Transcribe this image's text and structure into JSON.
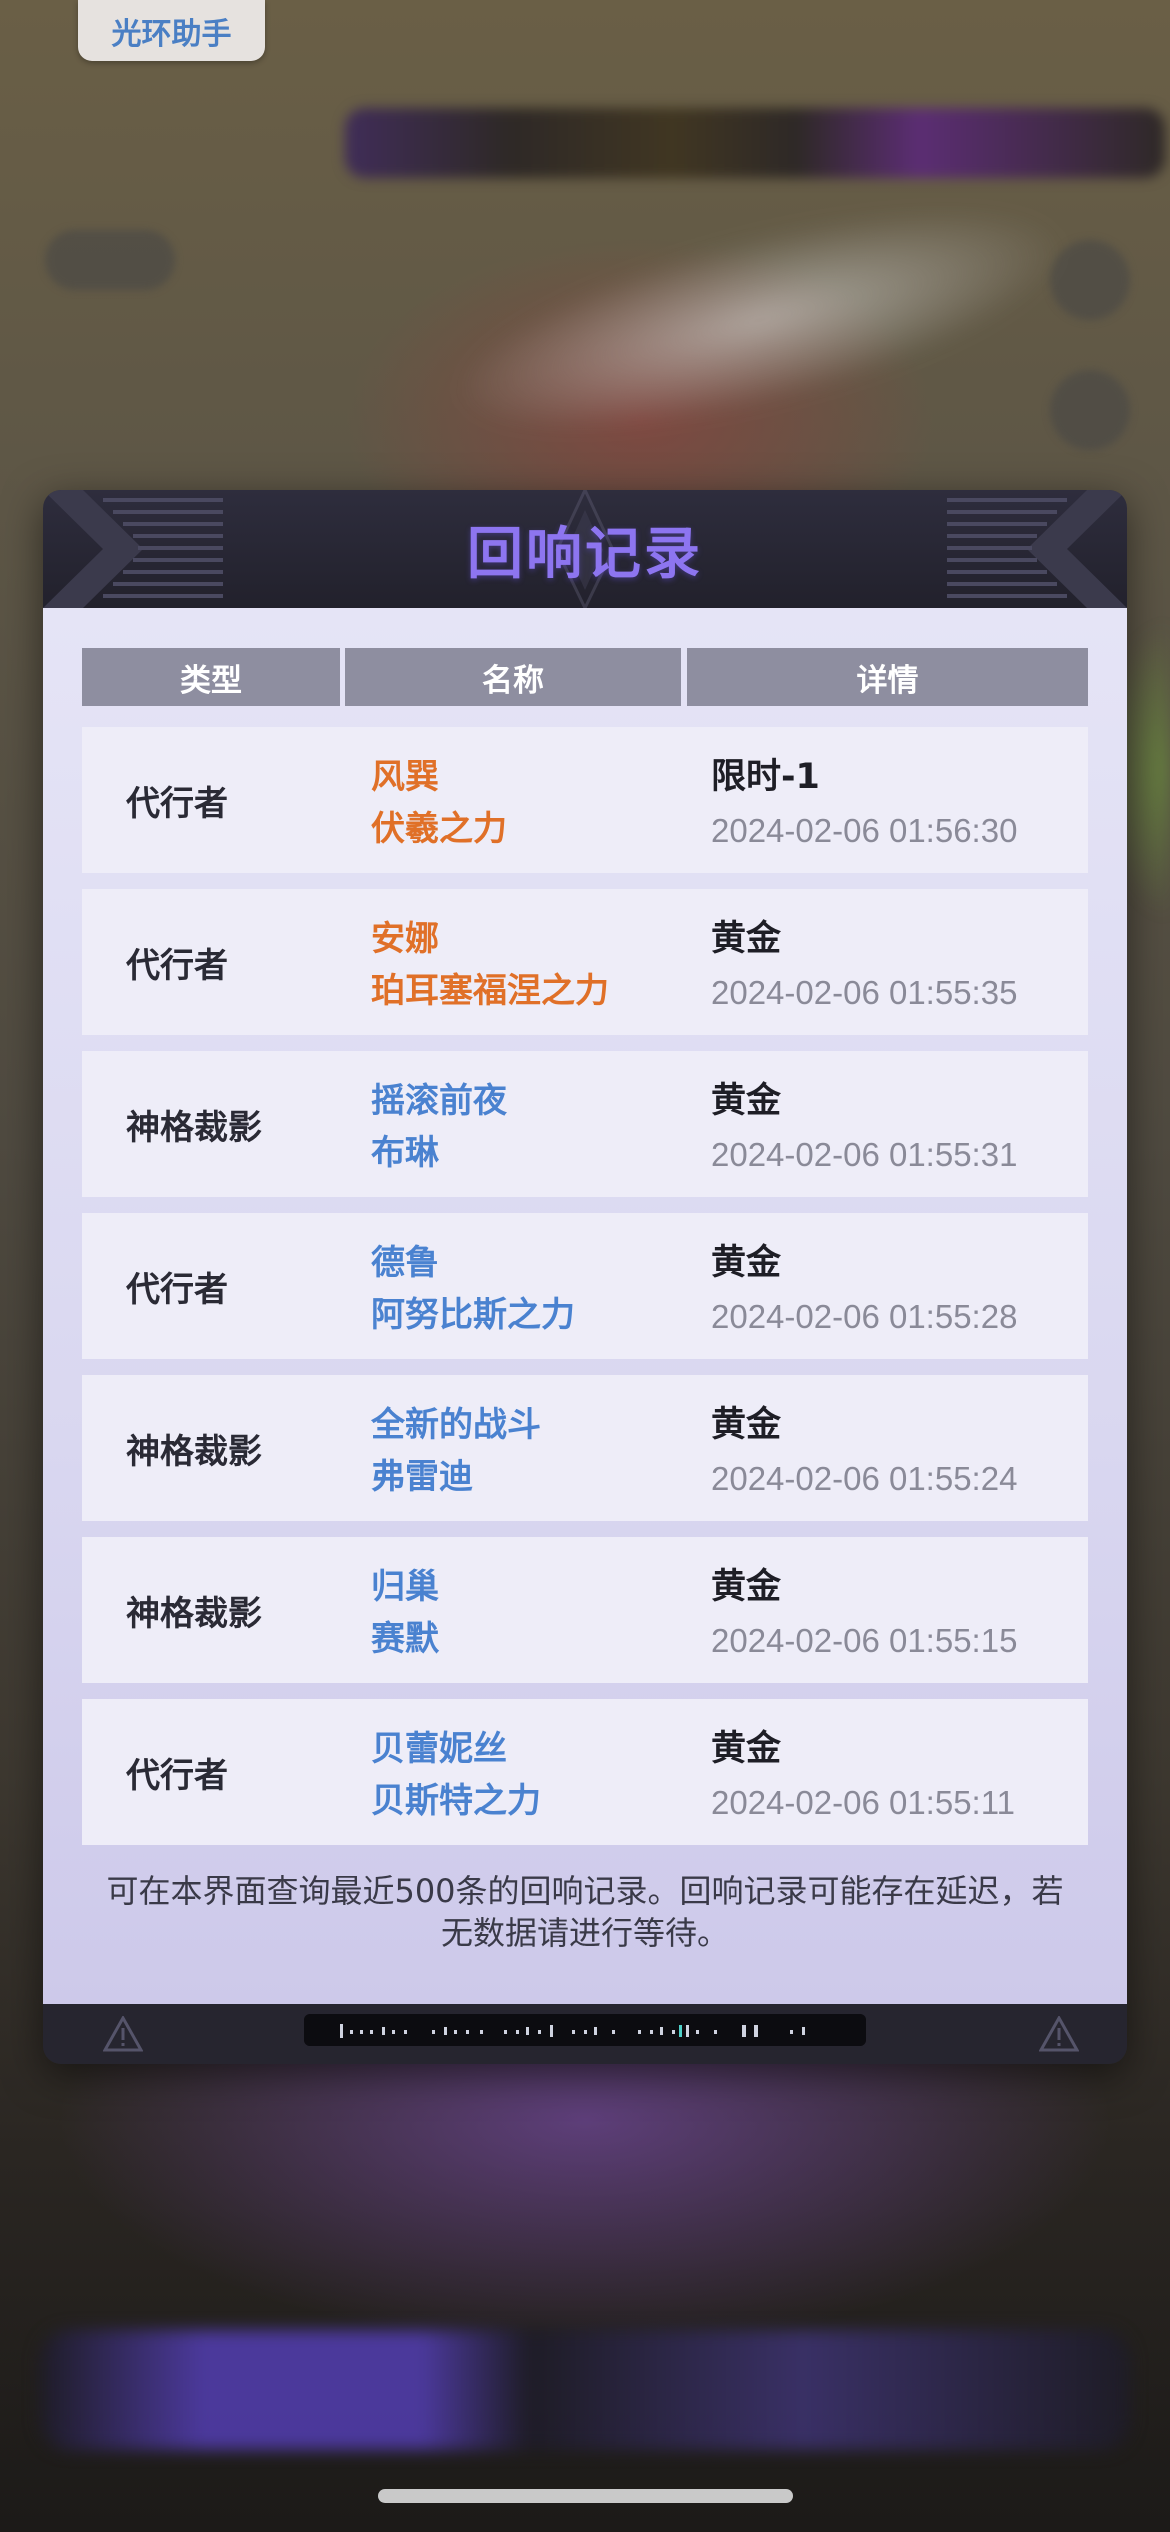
{
  "assistant_badge": {
    "label": "光环助手"
  },
  "dialog": {
    "title": "回响记录",
    "columns": [
      "类型",
      "名称",
      "详情"
    ],
    "rows": [
      {
        "type": "代行者",
        "name_line1": "风巽",
        "name_line2": "伏羲之力",
        "name_color": "#e07028",
        "detail": "限时-1",
        "time": "2024-02-06 01:56:30"
      },
      {
        "type": "代行者",
        "name_line1": "安娜",
        "name_line2": "珀耳塞福涅之力",
        "name_color": "#e07028",
        "detail": "黄金",
        "time": "2024-02-06 01:55:35"
      },
      {
        "type": "神格裁影",
        "name_line1": "摇滚前夜",
        "name_line2": "布琳",
        "name_color": "#4a82d0",
        "detail": "黄金",
        "time": "2024-02-06 01:55:31"
      },
      {
        "type": "代行者",
        "name_line1": "德鲁",
        "name_line2": "阿努比斯之力",
        "name_color": "#4a82d0",
        "detail": "黄金",
        "time": "2024-02-06 01:55:28"
      },
      {
        "type": "神格裁影",
        "name_line1": "全新的战斗",
        "name_line2": "弗雷迪",
        "name_color": "#4a82d0",
        "detail": "黄金",
        "time": "2024-02-06 01:55:24"
      },
      {
        "type": "神格裁影",
        "name_line1": "归巢",
        "name_line2": "赛默",
        "name_color": "#4a82d0",
        "detail": "黄金",
        "time": "2024-02-06 01:55:15"
      },
      {
        "type": "代行者",
        "name_line1": "贝蕾妮丝",
        "name_line2": "贝斯特之力",
        "name_color": "#4a82d0",
        "detail": "黄金",
        "time": "2024-02-06 01:55:11"
      }
    ],
    "footnote": "可在本界面查询最近500条的回响记录。回响记录可能存在延迟，若无数据请进行等待。"
  },
  "colors": {
    "title": "#8d75f0",
    "orange_name": "#e07028",
    "blue_name": "#4a82d0",
    "header_bg": "#22212c",
    "column_header_bg": "#8e8ea0"
  },
  "icons": [
    "warning-icon",
    "barcode-icon"
  ]
}
